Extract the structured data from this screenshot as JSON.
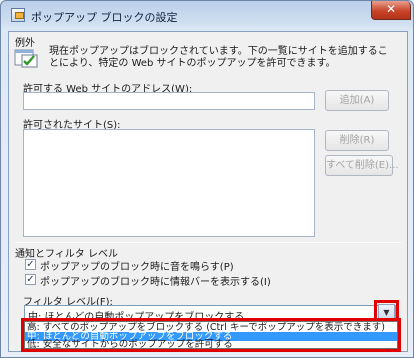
{
  "window": {
    "title": "ポップアップ ブロックの設定",
    "close_label": "✕"
  },
  "exceptions": {
    "group_label": "例外",
    "description": "現在ポップアップはブロックされています。下の一覧にサイトを追加することにより、特定の Web サイトのポップアップを許可できます。",
    "address_label": "許可する Web サイトのアドレス(W):",
    "address_value": "",
    "add_button": "追加(A)",
    "allowed_label": "許可されたサイト(S):",
    "remove_button": "削除(R)",
    "remove_all_button": "すべて削除(E)..."
  },
  "notifications": {
    "group_label": "通知とフィルタ レベル",
    "play_sound": "ポップアップのブロック時に音を鳴らす(P)",
    "show_infobar": "ポップアップのブロック時に情報バーを表示する(I)",
    "play_sound_checked": true,
    "show_infobar_checked": true,
    "filter_label": "フィルタ レベル(F):",
    "filter_selected": "中: ほとんどの自動ポップアップをブロックする",
    "filter_options": [
      "高: すべてのポップアップをブロックする (Ctrl キーでポップアップを表示できます)",
      "中: ほとんどの自動ポップアップをブロックする",
      "低: 安全なサイトからのポップアップを許可する"
    ],
    "highlighted_index": 1
  },
  "colors": {
    "highlight": "#3399ff",
    "annotation_red": "#e00000"
  }
}
